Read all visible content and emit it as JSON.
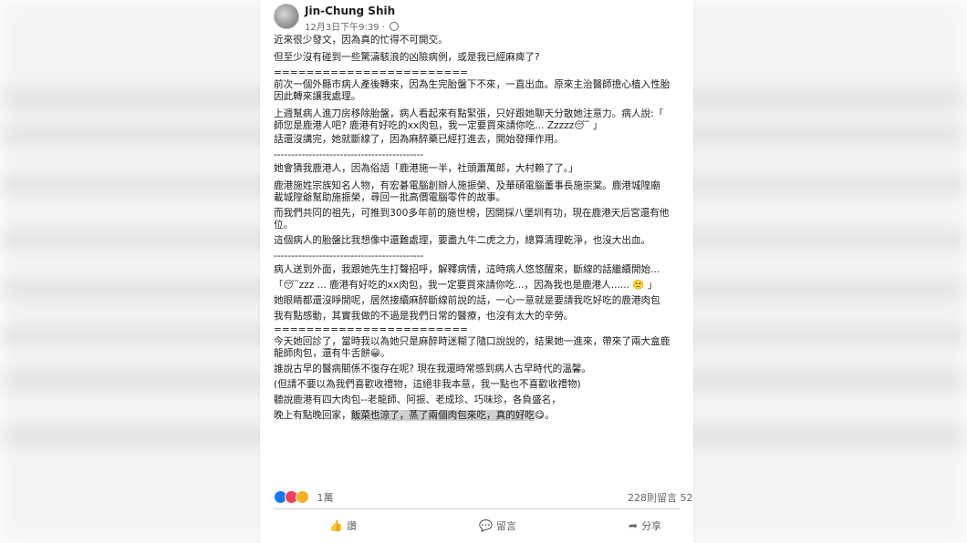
{
  "post": {
    "author": "Jin-Chung Shih",
    "timestamp": "12月3日下午9:39 · ",
    "privacy_icon": "globe-icon",
    "paragraphs": [
      "近來很少發文，因為真的忙得不可開交。",
      "但至少沒有碰到一些驚濤駭浪的凶險病例，或是我已經麻痺了?",
      "========================",
      "前次一個外縣市病人產後轉來，因為生完胎盤下不來，一直出血。原來主治醫師擔心植入性胎",
      "因此轉來讓我處理。",
      "上週幫病人進刀房移除胎盤，病人看起來有點緊張，只好跟她聊天分散她注意力。病人說:「",
      "師您是鹿港人吧? 鹿港有好吃的xx肉包，我一定要買來請你吃... Zzzzz😴 」",
      "話還沒講完，她就斷線了，因為麻醉藥已經打進去，開始發揮作用。",
      "-------------------------------------------",
      "她會猜我鹿港人，因為俗語「鹿港施一半，社頭蕭萬郎，大村賴了了。」",
      "鹿港施姓宗族知名人物，有宏碁電腦創辦人施振榮、及華碩電腦董事長施崇棠。鹿港城隍廟",
      "載城隍爺幫助施振榮，尋回一批高價電腦零件的故事。",
      "而我們共同的祖先，可推到300多年前的施世榜，因開採八堡圳有功，現在鹿港天后宮還有他",
      "位。",
      "這個病人的胎盤比我想像中還難處理，要盡九牛二虎之力，總算清理乾淨，也沒大出血。",
      "-------------------------------------------",
      "病人送到外面，我跟她先生打聲招呼，解釋病情，這時病人悠悠醒來，斷線的話繼續開始...",
      "「😴zzz ... 鹿港有好吃的xx肉包，我一定要買來請你吃...，因為我也是鹿港人...... 🙂 」",
      "她眼睛都還沒睜開呢，居然接續麻醉斷線前說的話，一心一意就是要請我吃好吃的鹿港肉包",
      "我有點感動，其實我做的不過是我們日常的醫療，也沒有太大的辛勞。",
      "========================",
      "今天她回診了，當時我以為她只是麻醉時迷糊了隨口說說的，結果她一進來，帶來了兩大盒鹿",
      "龍師肉包，還有牛舌餅😀。",
      "誰說古早的醫病關係不復存在呢? 現在我還時常感到病人古早時代的溫馨。",
      "(但請不要以為我們喜歡收禮物，這絕非我本意，我一點也不喜歡收禮物)",
      "聽說鹿港有四大肉包--老龍師、阿振、老成珍、巧味珍，各負盛名，",
      "晚上有點晚回家，"
    ],
    "last_highlight": "飯菜也涼了，蒸了兩個肉包來吃，真的好吃",
    "last_tail": "😋。"
  },
  "footer": {
    "reaction_count": "1萬",
    "comment_count": "228則留言",
    "share_count": "52",
    "like_label": "讚",
    "comment_label": "留言",
    "share_label": "分享"
  }
}
